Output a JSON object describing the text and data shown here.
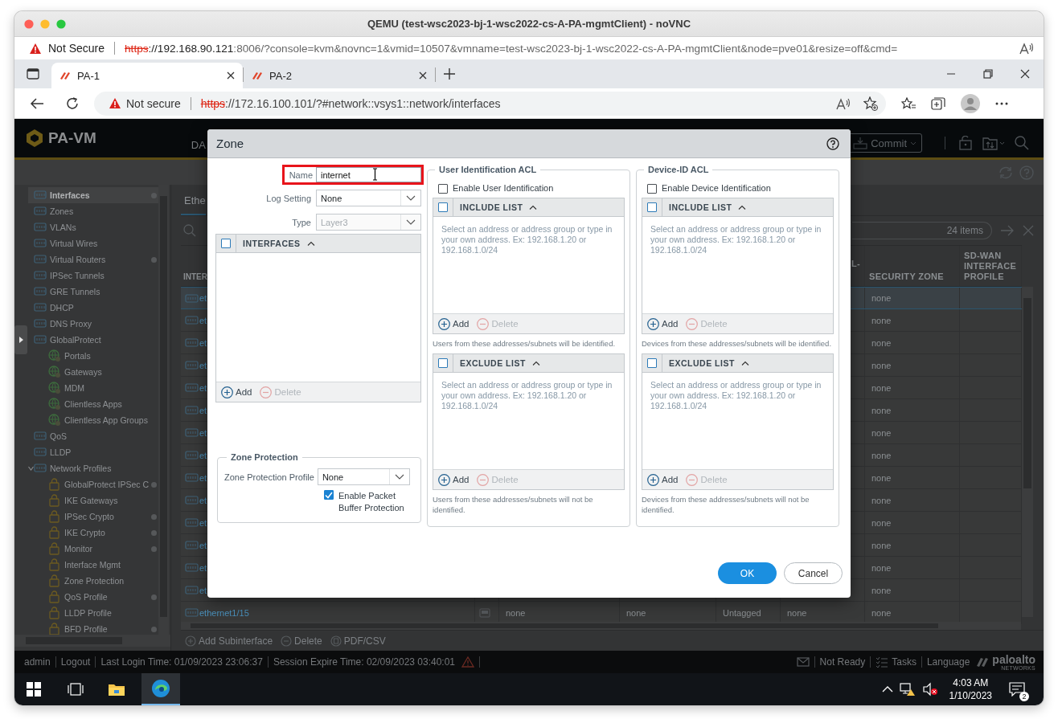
{
  "window": {
    "title": "QEMU (test-wsc2023-bj-1-wsc2022-cs-A-PA-mgmtClient) - noVNC"
  },
  "outer_address_bar": {
    "security": "Not Secure",
    "scheme": "https",
    "host": "://192.168.90.121",
    "path": ":8006/?console=kvm&novnc=1&vmid=10507&vmname=test-wsc2023-bj-1-wsc2022-cs-A-PA-mgmtClient&node=pve01&resize=off&cmd="
  },
  "browser": {
    "tabs": [
      {
        "title": "PA-1",
        "selected": true
      },
      {
        "title": "PA-2",
        "selected": false
      }
    ],
    "address_bar": {
      "security": "Not secure",
      "scheme": "https",
      "rest": "://172.16.100.101/?#network::vsys1::network/interfaces"
    }
  },
  "app": {
    "header": {
      "logo": "PA-VM",
      "nav_partial": "DA",
      "commit": "Commit"
    },
    "sidebar": {
      "items": [
        {
          "label": "Interfaces",
          "selected": true,
          "marked": true
        },
        {
          "label": "Zones",
          "selected": false,
          "marked": false
        },
        {
          "label": "VLANs",
          "selected": false,
          "marked": false
        },
        {
          "label": "Virtual Wires",
          "selected": false,
          "marked": false
        },
        {
          "label": "Virtual Routers",
          "selected": false,
          "marked": true
        },
        {
          "label": "IPSec Tunnels",
          "selected": false,
          "marked": false
        },
        {
          "label": "GRE Tunnels",
          "selected": false,
          "marked": false
        },
        {
          "label": "DHCP",
          "selected": false,
          "marked": false
        },
        {
          "label": "DNS Proxy",
          "selected": false,
          "marked": false
        },
        {
          "label": "GlobalProtect",
          "selected": false,
          "marked": false,
          "children": [
            {
              "label": "Portals",
              "selected": false,
              "marked": false
            },
            {
              "label": "Gateways",
              "selected": false,
              "marked": false
            },
            {
              "label": "MDM",
              "selected": false,
              "marked": false
            },
            {
              "label": "Clientless Apps",
              "selected": false,
              "marked": false
            },
            {
              "label": "Clientless App Groups",
              "selected": false,
              "marked": false
            }
          ]
        },
        {
          "label": "QoS",
          "selected": false,
          "marked": false
        },
        {
          "label": "LLDP",
          "selected": false,
          "marked": false
        },
        {
          "label": "Network Profiles",
          "selected": false,
          "marked": false,
          "expanded": true,
          "children": [
            {
              "label": "GlobalProtect IPSec C",
              "selected": false,
              "marked": true
            },
            {
              "label": "IKE Gateways",
              "selected": false,
              "marked": false
            },
            {
              "label": "IPSec Crypto",
              "selected": false,
              "marked": true
            },
            {
              "label": "IKE Crypto",
              "selected": false,
              "marked": true
            },
            {
              "label": "Monitor",
              "selected": false,
              "marked": true
            },
            {
              "label": "Interface Mgmt",
              "selected": false,
              "marked": false
            },
            {
              "label": "Zone Protection",
              "selected": false,
              "marked": false
            },
            {
              "label": "QoS Profile",
              "selected": false,
              "marked": true
            },
            {
              "label": "LLDP Profile",
              "selected": false,
              "marked": false
            },
            {
              "label": "BFD Profile",
              "selected": false,
              "marked": true
            }
          ]
        }
      ]
    },
    "content": {
      "tab": {
        "label": "Ethe",
        "selected": true
      },
      "filter": {
        "count": "24 items"
      },
      "table": {
        "columns": {
          "column_1": "INTER",
          "column_6": "L-",
          "column_7": "SECURITY ZONE",
          "column_8": "SD-WAN INTERFACE PROFILE"
        },
        "rows": [
          {
            "kind": "partial",
            "selected": true,
            "column_1": "et",
            "column_7": "none"
          },
          {
            "kind": "partial",
            "selected": false,
            "column_1": "et",
            "column_7": "none"
          },
          {
            "kind": "partial",
            "selected": false,
            "column_1": "et",
            "column_7": "none"
          },
          {
            "kind": "partial",
            "selected": false,
            "column_1": "et",
            "column_7": "none"
          },
          {
            "kind": "partial",
            "selected": false,
            "column_1": "et",
            "column_7": "none"
          },
          {
            "kind": "partial",
            "selected": false,
            "column_1": "et",
            "column_7": "none"
          },
          {
            "kind": "partial",
            "selected": false,
            "column_1": "et",
            "column_7": "none"
          },
          {
            "kind": "partial",
            "selected": false,
            "column_1": "et",
            "column_7": "none"
          },
          {
            "kind": "partial",
            "selected": false,
            "column_1": "et",
            "column_7": "none"
          },
          {
            "kind": "partial",
            "selected": false,
            "column_1": "et",
            "column_7": "none"
          },
          {
            "kind": "partial",
            "selected": false,
            "column_1": "et",
            "column_7": "none"
          },
          {
            "kind": "partial",
            "selected": false,
            "column_1": "et",
            "column_7": "none"
          },
          {
            "kind": "partial",
            "selected": false,
            "column_1": "et",
            "column_7": "none"
          },
          {
            "kind": "partial",
            "selected": false,
            "column_1": "et",
            "column_7": "none"
          },
          {
            "kind": "full",
            "selected": false,
            "column_1": "ethernet1/15",
            "column_3": "none",
            "column_4": "none",
            "column_5": "Untagged",
            "column_6": "none",
            "column_7": "none"
          }
        ]
      },
      "actions": [
        "Add Subinterface",
        "Delete",
        "PDF/CSV"
      ]
    },
    "status_bar": {
      "user": "admin",
      "logout": "Logout",
      "last_login": "Last Login Time: 01/09/2023 23:06:37",
      "session": "Session Expire Time: 02/09/2023 03:40:01",
      "not_ready": "Not Ready",
      "tasks": "Tasks",
      "language": "Language",
      "brand": "paloalto",
      "brand_sub": "NETWORKS"
    }
  },
  "dialog": {
    "title": "Zone",
    "name": {
      "label": "Name",
      "value": "internet",
      "highlighted": true
    },
    "log_setting": {
      "label": "Log Setting",
      "value": "None"
    },
    "type": {
      "label": "Type",
      "value": "Layer3",
      "disabled": true
    },
    "interfaces": {
      "header": "INTERFACES",
      "checked": false,
      "add": "Add",
      "delete": "Delete"
    },
    "zone_protection": {
      "legend": "Zone Protection",
      "profile_label": "Zone Protection Profile",
      "profile": "None",
      "buffer_protection": {
        "label": "Enable Packet Buffer Protection",
        "checked": true
      }
    },
    "acls": [
      {
        "legend": "User Identification ACL",
        "enable": {
          "label": "Enable User Identification",
          "checked": false
        },
        "lists": [
          {
            "header": "INCLUDE LIST",
            "checked": false,
            "empty_message": "Select an address or address group or type in your own address. Ex: 192.168.1.20 or 192.168.1.0/24",
            "add": "Add",
            "delete": "Delete",
            "note": "Users from these addresses/subnets will be identified."
          },
          {
            "header": "EXCLUDE LIST",
            "checked": false,
            "empty_message": "Select an address or address group or type in your own address. Ex: 192.168.1.20 or 192.168.1.0/24",
            "add": "Add",
            "delete": "Delete",
            "note": "Users from these addresses/subnets will not be identified."
          }
        ]
      },
      {
        "legend": "Device-ID ACL",
        "enable": {
          "label": "Enable Device Identification",
          "checked": false
        },
        "lists": [
          {
            "header": "INCLUDE LIST",
            "checked": false,
            "empty_message": "Select an address or address group or type in your own address. Ex: 192.168.1.20 or 192.168.1.0/24",
            "add": "Add",
            "delete": "Delete",
            "note": "Devices from these addresses/subnets will be identified."
          },
          {
            "header": "EXCLUDE LIST",
            "checked": false,
            "empty_message": "Select an address or address group or type in your own address. Ex: 192.168.1.20 or 192.168.1.0/24",
            "add": "Add",
            "delete": "Delete",
            "note": "Devices from these addresses/subnets will not be identified."
          }
        ]
      }
    ],
    "buttons": [
      {
        "label": "OK",
        "kind": "primary"
      },
      {
        "label": "Cancel",
        "kind": "secondary"
      }
    ]
  },
  "taskbar": {
    "time": "4:03 AM",
    "date": "1/10/2023",
    "notifications": "2"
  }
}
